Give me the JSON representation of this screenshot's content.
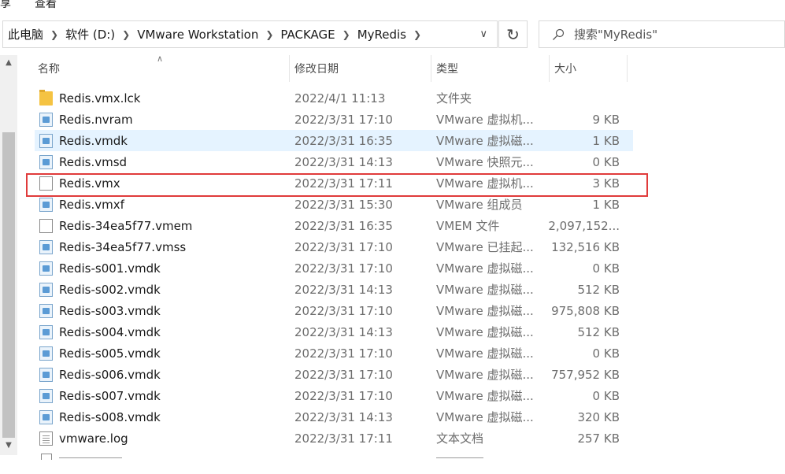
{
  "ribbon": {
    "tabs": [
      "享",
      "查看"
    ]
  },
  "breadcrumb": [
    "此电脑",
    "软件 (D:)",
    "VMware Workstation",
    "PACKAGE",
    "MyRedis"
  ],
  "search": {
    "placeholder": "搜索\"MyRedis\""
  },
  "columns": {
    "name": "名称",
    "date": "修改日期",
    "type": "类型",
    "size": "大小"
  },
  "files": [
    {
      "name": "Redis.vmx.lck",
      "date": "2022/4/1 11:13",
      "type": "文件夹",
      "size": "",
      "icon": "folder-icon"
    },
    {
      "name": "Redis.nvram",
      "date": "2022/3/31 17:10",
      "type": "VMware 虚拟机...",
      "size": "9 KB",
      "icon": "vmware-file-icon"
    },
    {
      "name": "Redis.vmdk",
      "date": "2022/3/31 16:35",
      "type": "VMware 虚拟磁...",
      "size": "1 KB",
      "icon": "vmware-disk-icon",
      "selected": true
    },
    {
      "name": "Redis.vmsd",
      "date": "2022/3/31 14:13",
      "type": "VMware 快照元...",
      "size": "0 KB",
      "icon": "vmware-file-icon"
    },
    {
      "name": "Redis.vmx",
      "date": "2022/3/31 17:11",
      "type": "VMware 虚拟机...",
      "size": "3 KB",
      "icon": "vmx-file-icon",
      "highlighted": true
    },
    {
      "name": "Redis.vmxf",
      "date": "2022/3/31 15:30",
      "type": "VMware 组成员",
      "size": "1 KB",
      "icon": "vmware-file-icon"
    },
    {
      "name": "Redis-34ea5f77.vmem",
      "date": "2022/3/31 16:35",
      "type": "VMEM 文件",
      "size": "2,097,152...",
      "icon": "generic-file-icon"
    },
    {
      "name": "Redis-34ea5f77.vmss",
      "date": "2022/3/31 17:10",
      "type": "VMware 已挂起...",
      "size": "132,516 KB",
      "icon": "vmware-suspend-icon"
    },
    {
      "name": "Redis-s001.vmdk",
      "date": "2022/3/31 17:10",
      "type": "VMware 虚拟磁...",
      "size": "0 KB",
      "icon": "vmware-disk-icon"
    },
    {
      "name": "Redis-s002.vmdk",
      "date": "2022/3/31 14:13",
      "type": "VMware 虚拟磁...",
      "size": "512 KB",
      "icon": "vmware-disk-icon"
    },
    {
      "name": "Redis-s003.vmdk",
      "date": "2022/3/31 17:10",
      "type": "VMware 虚拟磁...",
      "size": "975,808 KB",
      "icon": "vmware-disk-icon"
    },
    {
      "name": "Redis-s004.vmdk",
      "date": "2022/3/31 14:13",
      "type": "VMware 虚拟磁...",
      "size": "512 KB",
      "icon": "vmware-disk-icon"
    },
    {
      "name": "Redis-s005.vmdk",
      "date": "2022/3/31 17:10",
      "type": "VMware 虚拟磁...",
      "size": "0 KB",
      "icon": "vmware-disk-icon"
    },
    {
      "name": "Redis-s006.vmdk",
      "date": "2022/3/31 17:10",
      "type": "VMware 虚拟磁...",
      "size": "757,952 KB",
      "icon": "vmware-disk-icon"
    },
    {
      "name": "Redis-s007.vmdk",
      "date": "2022/3/31 17:10",
      "type": "VMware 虚拟磁...",
      "size": "0 KB",
      "icon": "vmware-disk-icon"
    },
    {
      "name": "Redis-s008.vmdk",
      "date": "2022/3/31 14:13",
      "type": "VMware 虚拟磁...",
      "size": "320 KB",
      "icon": "vmware-disk-icon"
    },
    {
      "name": "vmware.log",
      "date": "2022/3/31 17:11",
      "type": "文本文档",
      "size": "257 KB",
      "icon": "text-file-icon"
    }
  ],
  "colors": {
    "selected_row": "#e5f3ff",
    "highlight_border": "#e03b3b",
    "scroll_thumb": "#c2c2c2"
  }
}
